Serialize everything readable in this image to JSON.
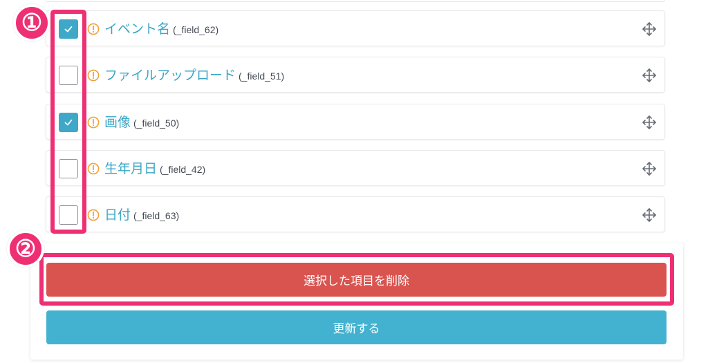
{
  "colors": {
    "accent": "#3fa8c9",
    "field_name": "#3aa6c6",
    "warning": "#f0a13a",
    "delete": "#d9534f",
    "update": "#43b2d0",
    "highlight": "#ee2f73"
  },
  "fields": [
    {
      "name": "イベント名",
      "id": "(_field_62)",
      "checked": true
    },
    {
      "name": "ファイルアップロード",
      "id": "(_field_51)",
      "checked": false
    },
    {
      "name": "画像",
      "id": "(_field_50)",
      "checked": true
    },
    {
      "name": "生年月日",
      "id": "(_field_42)",
      "checked": false
    },
    {
      "name": "日付",
      "id": "(_field_63)",
      "checked": false
    }
  ],
  "icons": {
    "check": "check-icon",
    "warning": "warning-icon",
    "move": "move-icon"
  },
  "actions": {
    "delete_label": "選択した項目を削除",
    "update_label": "更新する"
  },
  "annotations": {
    "badge_1": "①",
    "badge_2": "②"
  }
}
